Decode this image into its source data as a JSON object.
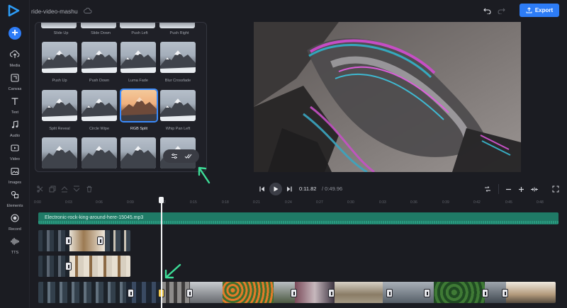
{
  "app": {
    "project_name": "ride-video-mashu",
    "export_label": "Export"
  },
  "rail": {
    "items": [
      {
        "label": "Media",
        "icon": "cloud-upload-icon"
      },
      {
        "label": "Canvas",
        "icon": "canvas-icon"
      },
      {
        "label": "Text",
        "icon": "text-icon"
      },
      {
        "label": "Audio",
        "icon": "music-note-icon"
      },
      {
        "label": "Video",
        "icon": "video-icon"
      },
      {
        "label": "Images",
        "icon": "image-icon"
      },
      {
        "label": "Elements",
        "icon": "shapes-icon"
      },
      {
        "label": "Record",
        "icon": "record-icon"
      },
      {
        "label": "TTS",
        "icon": "waveform-icon"
      }
    ]
  },
  "transitions": {
    "top_labels": [
      "Slide Up",
      "Slide Down",
      "Push Left",
      "Push Right"
    ],
    "row2_labels": [
      "Push Up",
      "Push Down",
      "Luma Fade",
      "Blur Crossfade"
    ],
    "row3_labels": [
      "Split Reveal",
      "Circle Wipe",
      "RGB Split",
      "Whip Pan Left"
    ],
    "selected": "RGB Split"
  },
  "player": {
    "current_time": "0:11.82",
    "total_time": "/ 0:49.96"
  },
  "timeline": {
    "ruler_labels": [
      "0:03",
      "0:06",
      "0:09",
      "0:12",
      "0:15",
      "0:18",
      "0:21",
      "0:24",
      "0:27",
      "0:30",
      "0:33",
      "0:36",
      "0:39",
      "0:42",
      "0:45",
      "0:48"
    ],
    "audio_clip_name": "Electronic-rock-king-around-here-15045.mp3"
  },
  "colors": {
    "accent": "#2d7cf6",
    "audio_track": "#1f7a66",
    "annotation_arrow": "#3ddc97"
  }
}
